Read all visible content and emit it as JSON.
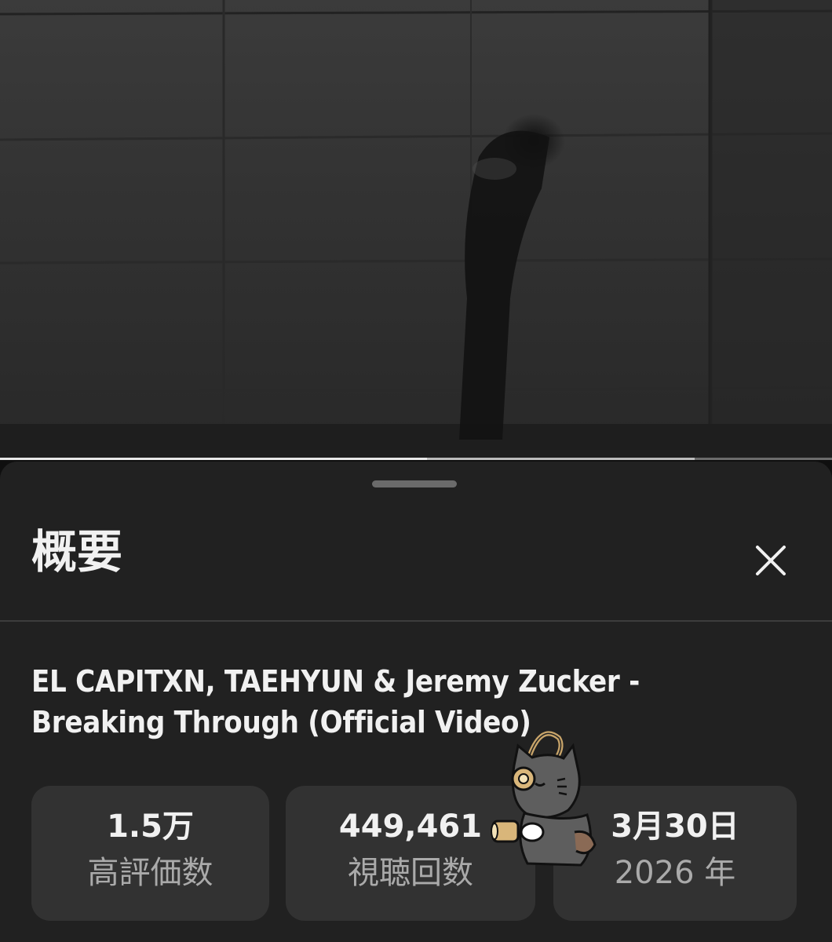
{
  "video": {
    "progress_fraction": 0.513,
    "buffered_fraction": 0.835
  },
  "sheet": {
    "title": "概要",
    "close_icon": "close-icon"
  },
  "details": {
    "title_line1": "EL CAPITXN, TAEHYUN & Jeremy Zucker -",
    "title_line2": "Breaking Through (Official Video)"
  },
  "stats": [
    {
      "value": "1.5万",
      "label": "高評価数"
    },
    {
      "value": "449,461",
      "label": "視聴回数"
    },
    {
      "value": "3月30日",
      "label": "2026 年"
    }
  ],
  "colors": {
    "sheet_bg": "#212121",
    "card_bg": "#323232",
    "text_primary": "#f1f1f1",
    "text_secondary": "#aaaaaa"
  }
}
